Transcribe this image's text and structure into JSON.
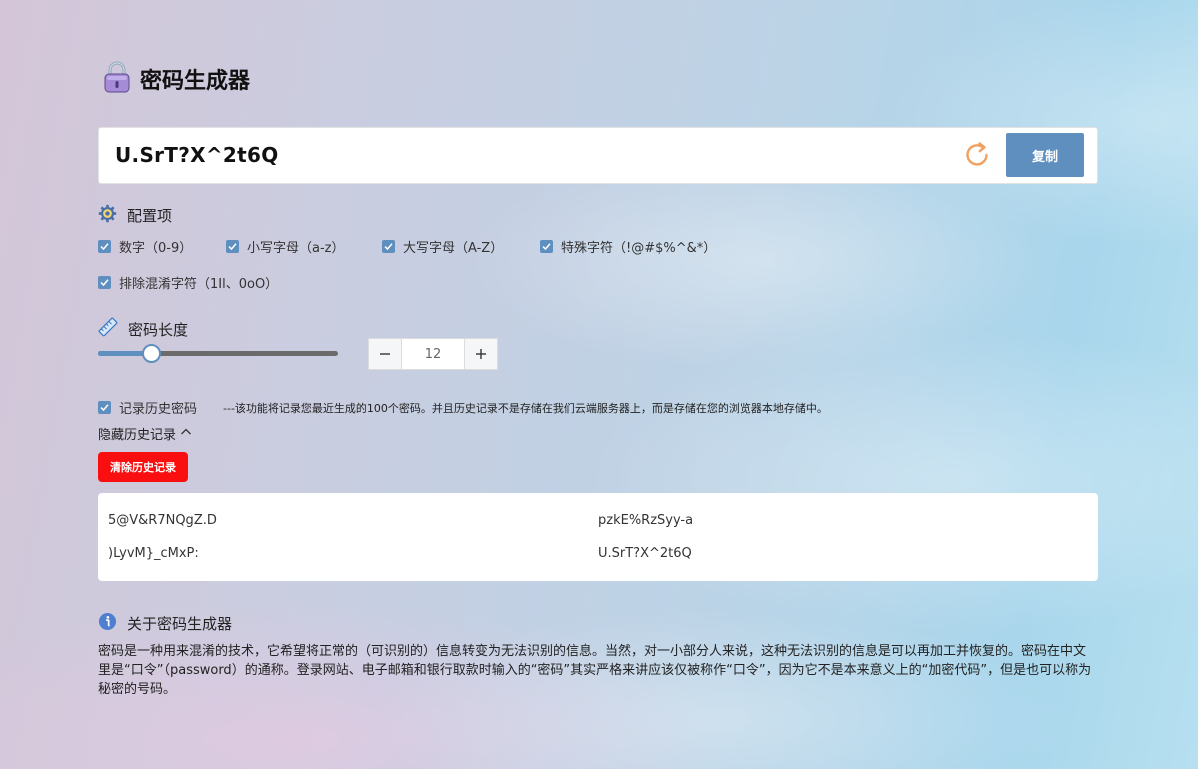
{
  "header": {
    "title": "密码生成器",
    "icon": "lock-icon"
  },
  "password": {
    "value": "U.SrT?X^2t6Q",
    "copy_label": "复制",
    "accent_color": "#5f8fbf",
    "refresh_color": "#f0a060"
  },
  "config": {
    "heading": "配置项",
    "options": [
      {
        "label": "数字（0-9）",
        "checked": true
      },
      {
        "label": "小写字母（a-z）",
        "checked": true
      },
      {
        "label": "大写字母（A-Z）",
        "checked": true
      },
      {
        "label": "特殊字符（!@#$%^&*）",
        "checked": true
      },
      {
        "label": "排除混淆字符（1Il、0oO）",
        "checked": true
      }
    ]
  },
  "length": {
    "heading": "密码长度",
    "value": "12",
    "slider_fraction": 0.22
  },
  "history": {
    "record_label": "记录历史密码",
    "record_checked": true,
    "note": "---该功能将记录您最近生成的100个密码。并且历史记录不是存储在我们云端服务器上，而是存储在您的浏览器本地存储中。",
    "toggle_label": "隐藏历史记录",
    "clear_label": "清除历史记录",
    "clear_color": "#f90f0f",
    "entries": [
      "5@V&R7NQgZ.D",
      "pzkE%RzSyy-a",
      ")LyvM}_cMxP:",
      "U.SrT?X^2t6Q"
    ]
  },
  "about": {
    "heading": "关于密码生成器",
    "text": "密码是一种用来混淆的技术，它希望将正常的（可识别的）信息转变为无法识别的信息。当然，对一小部分人来说，这种无法识别的信息是可以再加工并恢复的。密码在中文里是“口令”（password）的通称。登录网站、电子邮箱和银行取款时输入的“密码”其实严格来讲应该仅被称作“口令”，因为它不是本来意义上的“加密代码”，但是也可以称为秘密的号码。"
  }
}
